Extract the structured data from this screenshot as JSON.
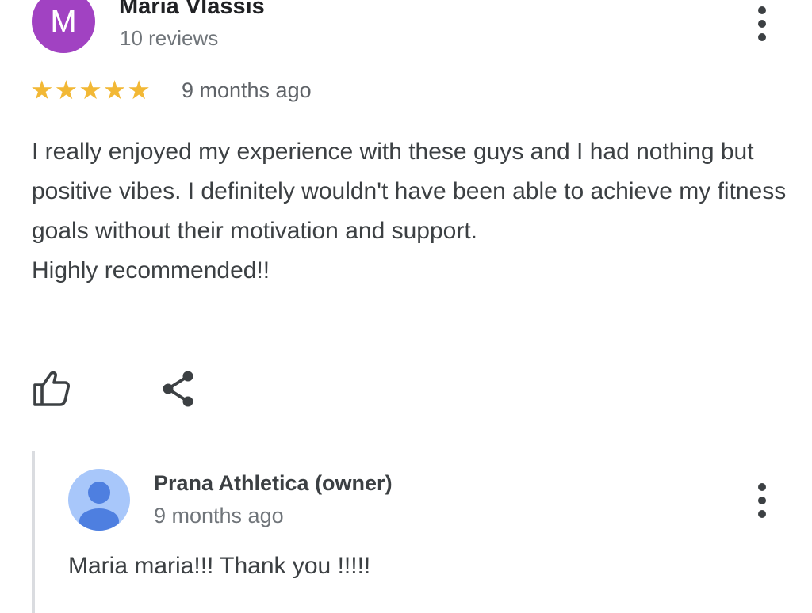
{
  "review": {
    "author": {
      "initial": "M",
      "name": "Maria Vlassis",
      "meta": "10 reviews"
    },
    "rating": {
      "value": 5,
      "max": 5,
      "icon": "star-icon"
    },
    "date": "9 months ago",
    "text": "I really enjoyed my experience with these guys and I had nothing but positive vibes. I definitely wouldn't have been able to achieve my fitness goals without their motivation and support.\nHighly recommended!!",
    "actions": [
      {
        "icon": "thumbs-up-icon"
      },
      {
        "icon": "share-icon"
      }
    ],
    "menu_icon": "more-vert-icon"
  },
  "owner_response": {
    "name": "Prana Athletica (owner)",
    "date": "9 months ago",
    "text": "Maria maria!!! Thank you !!!!!",
    "avatar_icon": "person-icon",
    "menu_icon": "more-vert-icon"
  },
  "colors": {
    "avatar_bg": "#a142c2",
    "star": "#f2b835",
    "owner_avatar_bg": "#a8c7fa",
    "owner_avatar_fg": "#4e7fe0",
    "text": "#3c4043",
    "muted": "#70757a",
    "divider": "#dadce0"
  }
}
